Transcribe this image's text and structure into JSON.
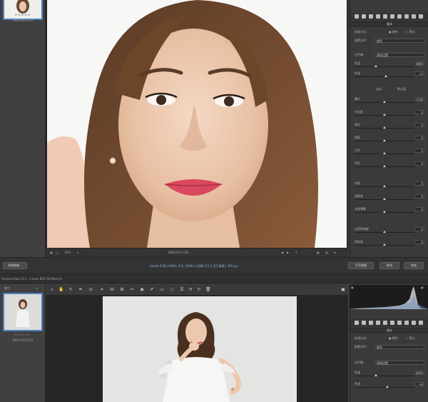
{
  "top_window": {
    "film_caption": "DWL1651.CR2",
    "stars": "★★★★★",
    "canvas_status": {
      "zoom": "16%",
      "filename": "DWL1651.CR2",
      "page": "1"
    },
    "info_line": "Adobe RGB (1998); 8 位; 2848 x 4288 (12.2 百万像素); 300 ppi",
    "buttons": {
      "save_image": "存储图像...",
      "open_image": "打开图像",
      "cancel": "取消",
      "done": "完成"
    },
    "panel": {
      "section_title": "基本",
      "treatment_label": "处理方式:",
      "treatment_color": "颜色",
      "treatment_bw": "黑白",
      "profile_label": "配置文件:",
      "profile_value": "颜色",
      "white_balance_label": "白平衡:",
      "white_balance_value": "原照设置",
      "temp_label": "色温",
      "temp_value": "4800",
      "tint_label": "色调",
      "tint_value": "+2",
      "auto_label": "自动",
      "default_label": "默认值",
      "sliders": [
        {
          "label": "曝光",
          "value": "0.00",
          "level": 0.5
        },
        {
          "label": "对比度",
          "value": "0",
          "level": 0.5
        },
        {
          "label": "高光",
          "value": "0",
          "level": 0.5
        },
        {
          "label": "阴影",
          "value": "0",
          "level": 0.5
        },
        {
          "label": "白色",
          "value": "0",
          "level": 0.5
        },
        {
          "label": "黑色",
          "value": "0",
          "level": 0.5
        },
        {
          "label": "纹理",
          "value": "0",
          "level": 0.5
        },
        {
          "label": "清晰度",
          "value": "0",
          "level": 0.5
        },
        {
          "label": "去除薄雾",
          "value": "0",
          "level": 0.5
        },
        {
          "label": "自然饱和度",
          "value": "0",
          "level": 0.5
        },
        {
          "label": "饱和度",
          "value": "0",
          "level": 0.5
        }
      ]
    }
  },
  "bottom_window": {
    "title": "Camera Raw 12.1 - Canon EOS 5D Mark III",
    "filmstrip_header": "胶片",
    "film_caption": "DWL1070.CR2",
    "stars": "★★★★★",
    "panel": {
      "section_title": "基本",
      "treatment_label": "处理方式:",
      "treatment_color": "颜色",
      "treatment_bw": "黑白",
      "profile_label": "配置文件:",
      "profile_value": "颜色",
      "white_balance_label": "白平衡:",
      "white_balance_value": "原照设置",
      "temp_label": "色温",
      "temp_value": "4900",
      "tint_label": "色调",
      "tint_value": "+8"
    }
  },
  "colors": {
    "accent": "#4d7fc0",
    "panel_bg": "#3a3a3a",
    "canvas_bg": "#262626"
  }
}
